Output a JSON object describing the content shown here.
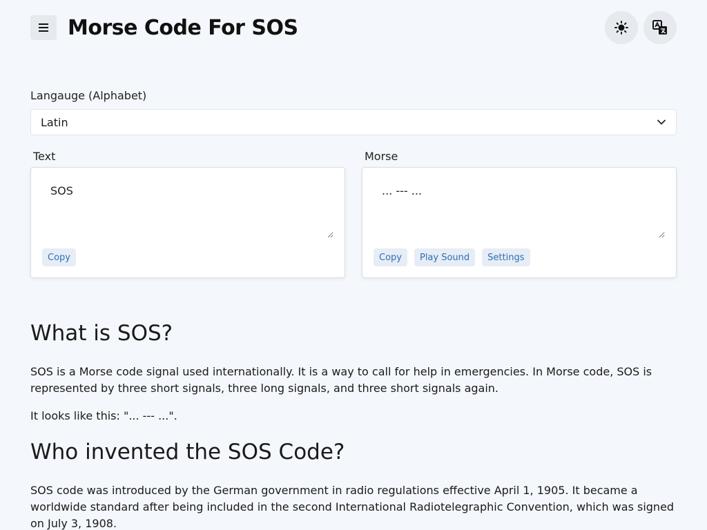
{
  "header": {
    "title": "Morse Code For SOS",
    "menu_icon": "menu-icon",
    "theme_icon": "sun-icon",
    "translate_icon": "translate-icon"
  },
  "language": {
    "label": "Langauge (Alphabet)",
    "selected": "Latin"
  },
  "text_panel": {
    "label": "Text",
    "value": "SOS",
    "copy_label": "Copy"
  },
  "morse_panel": {
    "label": "Morse",
    "value": "... --- ...",
    "copy_label": "Copy",
    "play_label": "Play Sound",
    "settings_label": "Settings"
  },
  "article": {
    "h1": "What is SOS?",
    "p1": "SOS is a Morse code signal used internationally. It is a way to call for help in emergencies. In Morse code, SOS is represented by three short signals, three long signals, and three short signals again.",
    "p2": "It looks like this: \"... --- ...\".",
    "h2": "Who invented the SOS Code?",
    "p3": "SOS code was introduced by the German government in radio regulations effective April 1, 1905. It became a worldwide standard after being included in the second International Radiotelegraphic Convention, which was signed on July 3, 1908."
  },
  "colors": {
    "background": "#f4f7fb",
    "accent": "#2f6fb3",
    "button_bg": "#e6edf6"
  }
}
